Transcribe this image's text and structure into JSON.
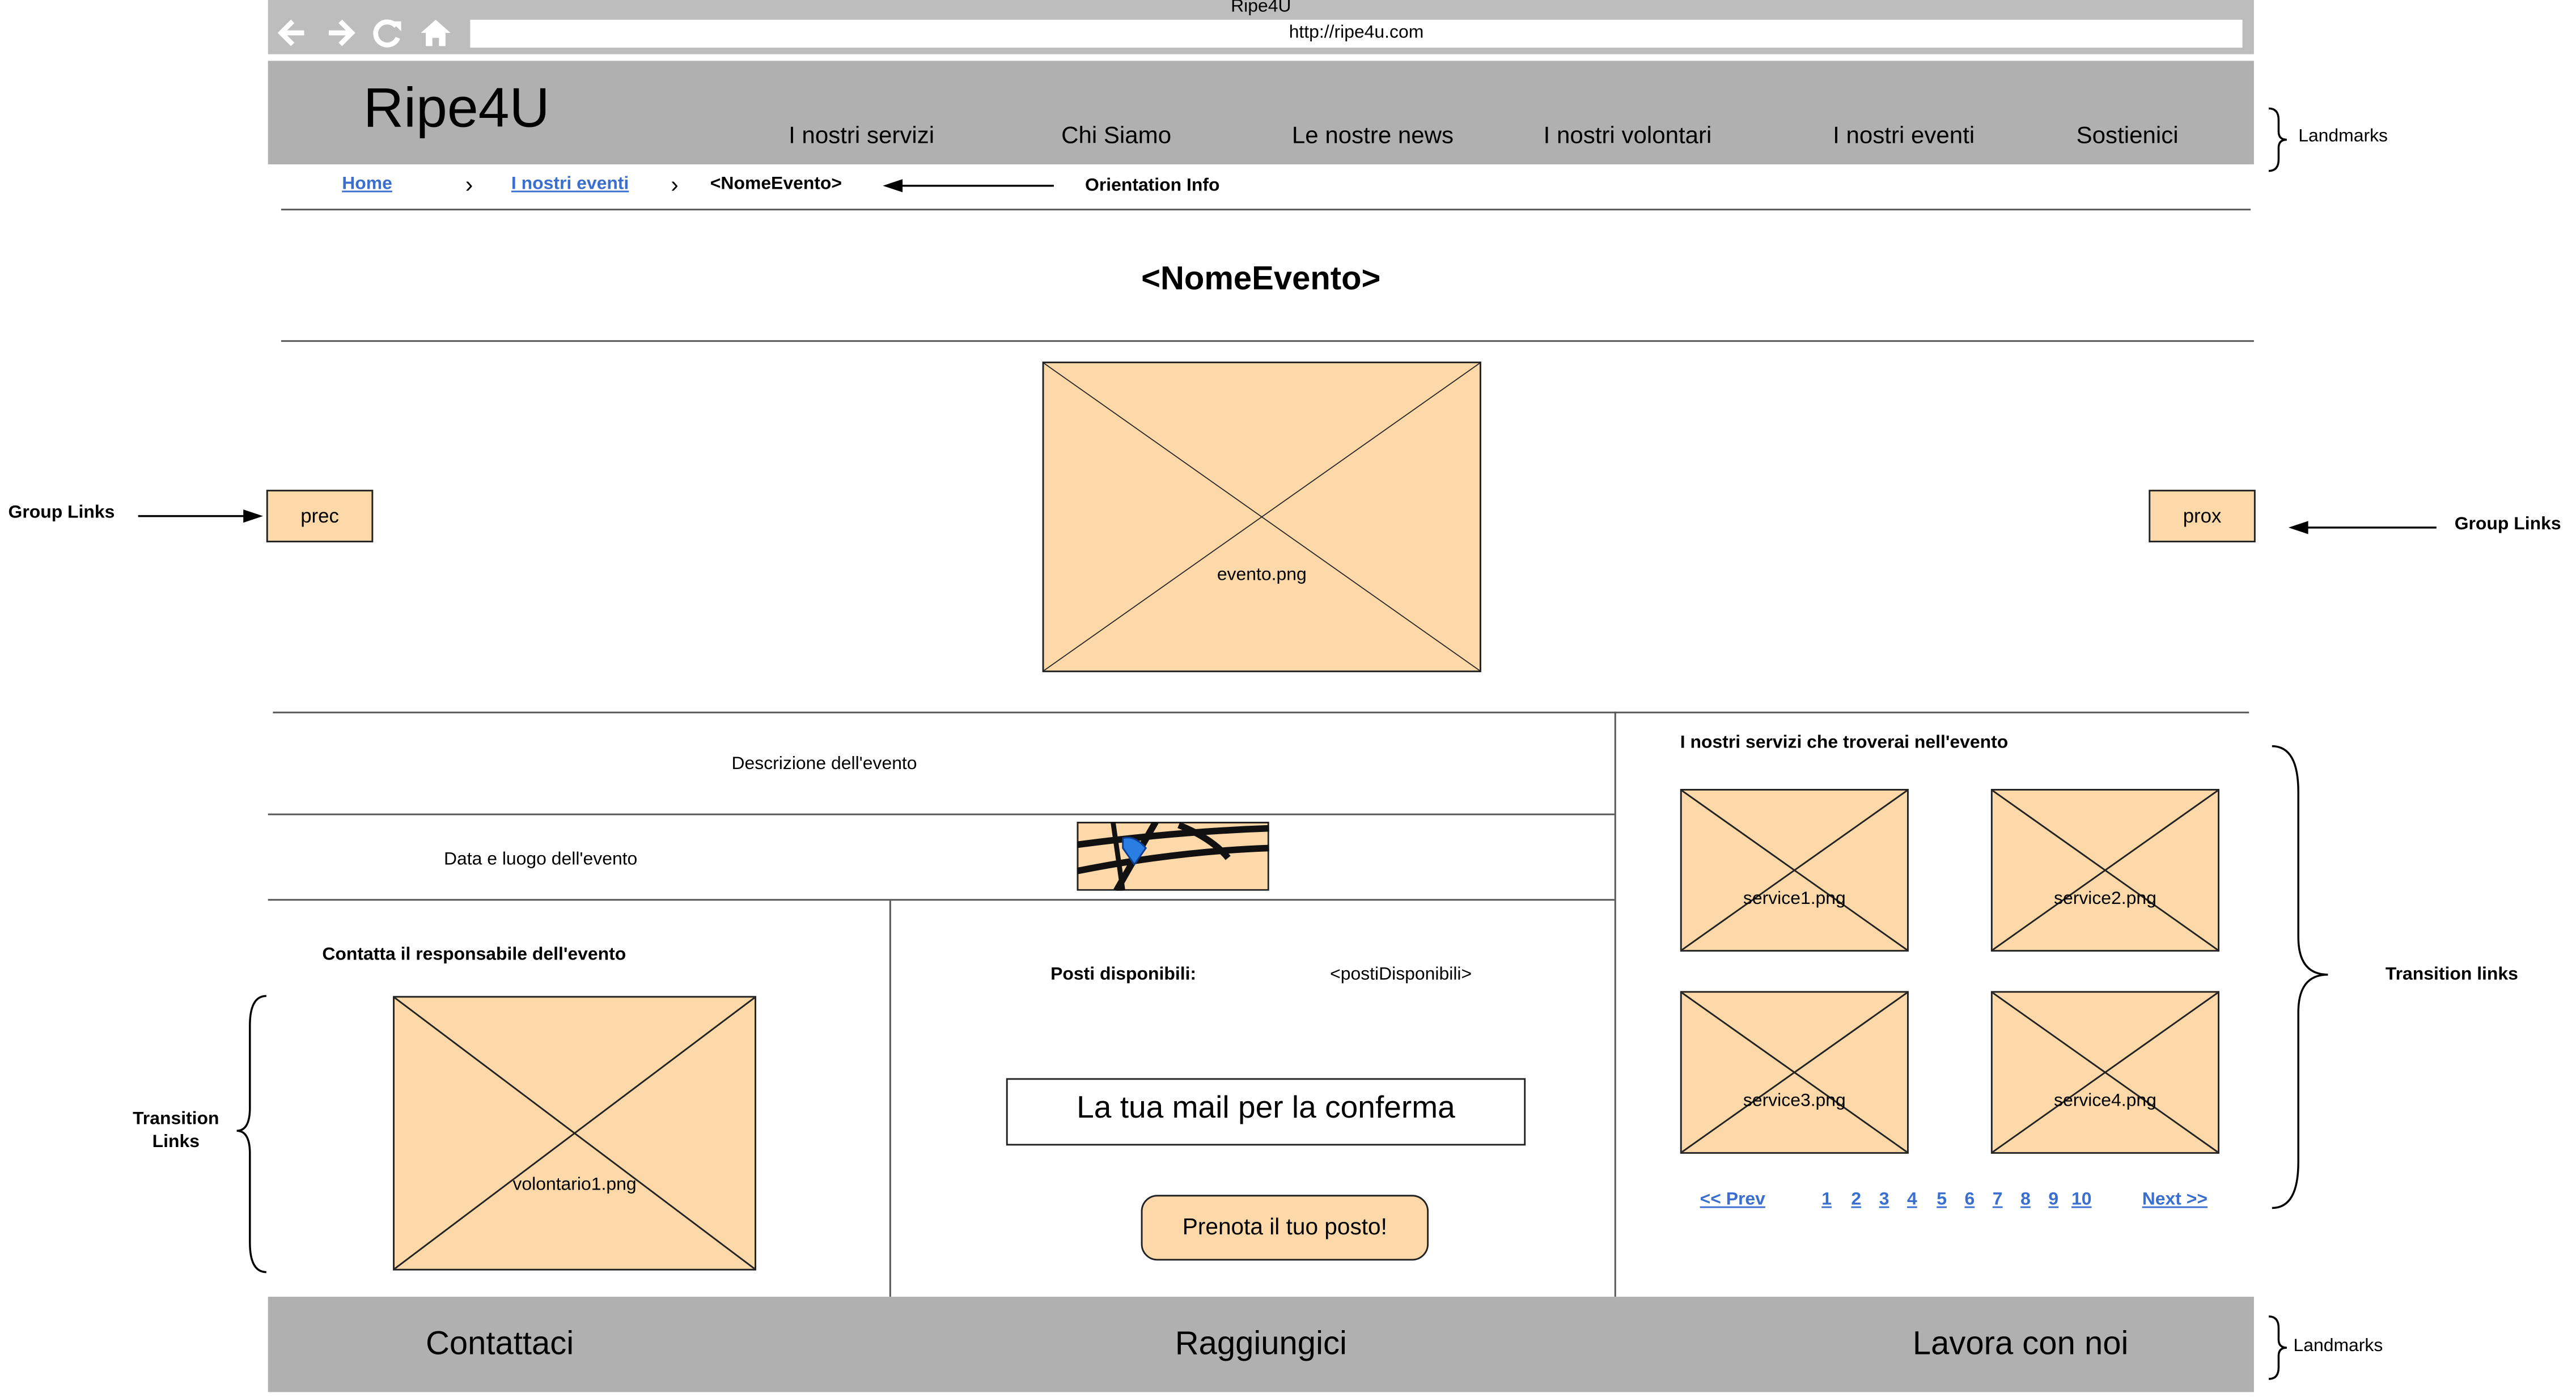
{
  "browser": {
    "window_title": "Ripe4U",
    "url": "http://ripe4u.com",
    "icons": [
      "back-arrow-icon",
      "forward-arrow-icon",
      "reload-icon",
      "home-icon"
    ]
  },
  "header": {
    "logo": "Ripe4U",
    "nav": [
      "I nostri servizi",
      "Chi Siamo",
      "Le nostre news",
      "I nostri volontari",
      "I nostri eventi",
      "Sostienici"
    ]
  },
  "breadcrumb": {
    "home": "Home",
    "events": "I nostri eventi",
    "current": "<NomeEvento>"
  },
  "page_title": "<NomeEvento>",
  "gallery": {
    "prev": "prec",
    "next": "prox",
    "image": "evento.png"
  },
  "details": {
    "description": "Descrizione dell'evento",
    "date_place": "Data e luogo dell'evento",
    "map_icon": "map-icon"
  },
  "contact": {
    "title": "Contatta il responsabile dell'evento",
    "image": "volontario1.png"
  },
  "booking": {
    "seats_label": "Posti disponibili:",
    "seats_value": "<postiDisponibili>",
    "email_placeholder": "La tua mail per la conferma",
    "submit": "Prenota il tuo posto!"
  },
  "services": {
    "title": "I nostri servizi che troverai nell'evento",
    "items": [
      "service1.png",
      "service2.png",
      "service3.png",
      "service4.png"
    ],
    "pagination": {
      "prev": "<< Prev",
      "pages": [
        "1",
        "2",
        "3",
        "4",
        "5",
        "6",
        "7",
        "8",
        "9",
        "10"
      ],
      "next": "Next >>"
    }
  },
  "footer": {
    "items": [
      "Contattaci",
      "Raggiungici",
      "Lavora con noi"
    ]
  },
  "annotations": {
    "landmarks_top": "Landmarks",
    "orientation": "Orientation Info",
    "group_links_left": "Group Links",
    "group_links_right": "Group Links",
    "transition_links_right": "Transition links",
    "transition_links_left": "Transition\nLinks",
    "landmarks_bottom": "Landmarks"
  },
  "colors": {
    "placeholder_fill": "#fdd8a8",
    "bar_gray": "#b0b0b0",
    "link_blue": "#3a6fd0"
  }
}
